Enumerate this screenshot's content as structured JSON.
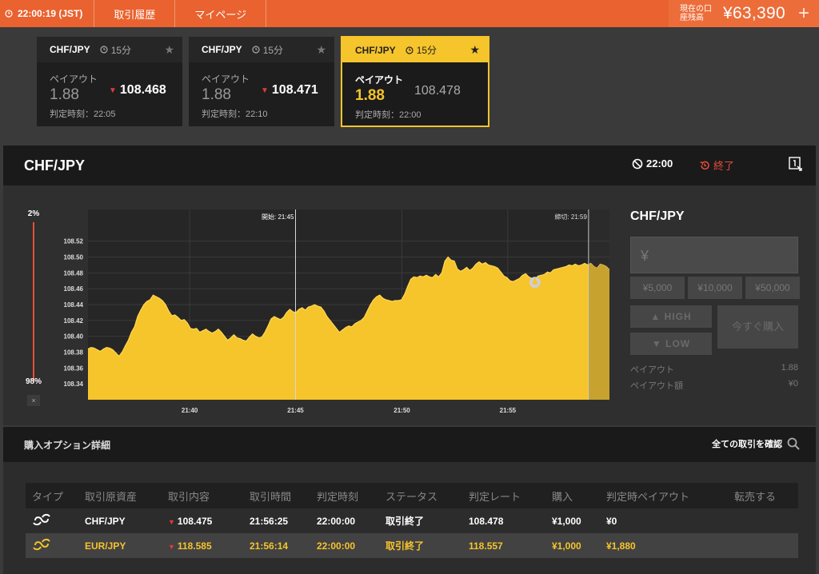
{
  "topbar": {
    "clock": "22:00:19 (JST)",
    "nav": [
      "取引履歴",
      "マイページ"
    ],
    "balance_label": "現在の口座残高",
    "balance_value": "¥63,390",
    "plus": "+"
  },
  "cards": [
    {
      "asset": "CHF/JPY",
      "duration": "15分",
      "payout_label": "ペイアウト",
      "payout": "1.88",
      "rate": "108.468",
      "judge": "判定時刻：22:05"
    },
    {
      "asset": "CHF/JPY",
      "duration": "15分",
      "payout_label": "ペイアウト",
      "payout": "1.88",
      "rate": "108.471",
      "judge": "判定時刻：22:10"
    },
    {
      "asset": "CHF/JPY",
      "duration": "15分",
      "payout_label": "ペイアウト",
      "payout": "1.88",
      "rate": "108.478",
      "judge": "判定時刻：22:00"
    }
  ],
  "asset_bar": {
    "title": "CHF/JPY",
    "time": "22:00",
    "status": "終了"
  },
  "slider": {
    "top": "2%",
    "bottom": "98%",
    "close": "×"
  },
  "chart_data": {
    "type": "area",
    "y_ticks": [
      "108.52",
      "108.50",
      "108.48",
      "108.46",
      "108.44",
      "108.42",
      "108.40",
      "108.38",
      "108.36",
      "108.34"
    ],
    "ylim": [
      108.32,
      108.56
    ],
    "x_ticks": [
      "21:40",
      "21:45",
      "21:50",
      "21:55"
    ],
    "start_label": "開始: 21:45",
    "end_label": "締切: 21:59",
    "series": [
      {
        "color": "#f6c42b",
        "values": [
          108.384,
          108.386,
          108.385,
          108.383,
          108.381,
          108.384,
          108.386,
          108.385,
          108.383,
          108.379,
          108.375,
          108.38,
          108.388,
          108.395,
          108.405,
          108.412,
          108.425,
          108.433,
          108.44,
          108.444,
          108.446,
          108.452,
          108.45,
          108.448,
          108.445,
          108.44,
          108.432,
          108.426,
          108.427,
          108.424,
          108.42,
          108.421,
          108.417,
          108.41,
          108.409,
          108.41,
          108.405,
          108.407,
          108.409,
          108.406,
          108.404,
          108.406,
          108.409,
          108.405,
          108.4,
          108.395,
          108.398,
          108.402,
          108.398,
          108.397,
          108.395,
          108.394,
          108.399,
          108.403,
          108.4,
          108.398,
          108.399,
          108.405,
          108.413,
          108.422,
          108.425,
          108.423,
          108.421,
          108.424,
          108.43,
          108.434,
          108.431,
          108.43,
          108.434,
          108.436,
          108.433,
          108.437,
          108.438,
          108.44,
          108.438,
          108.437,
          108.432,
          108.425,
          108.42,
          108.415,
          108.41,
          108.405,
          108.408,
          108.411,
          108.413,
          108.412,
          108.416,
          108.418,
          108.42,
          108.424,
          108.432,
          108.44,
          108.446,
          108.45,
          108.452,
          108.448,
          108.446,
          108.445,
          108.444,
          108.445,
          108.445,
          108.446,
          108.453,
          108.463,
          108.472,
          108.475,
          108.474,
          108.476,
          108.475,
          108.477,
          108.475,
          108.474,
          108.478,
          108.475,
          108.48,
          108.495,
          108.5,
          108.496,
          108.495,
          108.485,
          108.482,
          108.484,
          108.487,
          108.483,
          108.486,
          108.491,
          108.494,
          108.491,
          108.493,
          108.49,
          108.489,
          108.488,
          108.486,
          108.481,
          108.476,
          108.474,
          108.47,
          108.469,
          108.471,
          108.473,
          108.477,
          108.479,
          108.475,
          108.473,
          108.472,
          108.476,
          108.477,
          108.478,
          108.481,
          108.48,
          108.484,
          108.485,
          108.486,
          108.487,
          108.488,
          108.49,
          108.489,
          108.491,
          108.489,
          108.49,
          108.492,
          108.49,
          108.492,
          108.488,
          108.486,
          108.491,
          108.49,
          108.488,
          108.484
        ]
      }
    ]
  },
  "order": {
    "title": "CHF/JPY",
    "amount_placeholder": "¥",
    "presets": [
      "¥5,000",
      "¥10,000",
      "¥50,000"
    ],
    "high": "HIGH",
    "low": "LOW",
    "buy_now": "今すぐ購入",
    "payout_label": "ペイアウト",
    "payout_value": "1.88",
    "payout_amount_label": "ペイアウト額",
    "payout_amount_value": "¥0"
  },
  "details": {
    "title": "購入オプション詳細",
    "link": "全ての取引を確認",
    "columns": [
      "タイプ",
      "取引原資産",
      "取引内容",
      "取引時間",
      "判定時刻",
      "ステータス",
      "判定レート",
      "購入",
      "判定時ペイアウト",
      "転売する"
    ],
    "rows": [
      {
        "asset": "CHF/JPY",
        "content": "108.475",
        "time": "21:56:25",
        "judge": "22:00:00",
        "status": "取引終了",
        "rate": "108.478",
        "buy": "¥1,000",
        "payout": "¥0"
      },
      {
        "asset": "EUR/JPY",
        "content": "118.585",
        "time": "21:56:14",
        "judge": "22:00:00",
        "status": "取引終了",
        "rate": "118.557",
        "buy": "¥1,000",
        "payout": "¥1,880"
      }
    ]
  }
}
